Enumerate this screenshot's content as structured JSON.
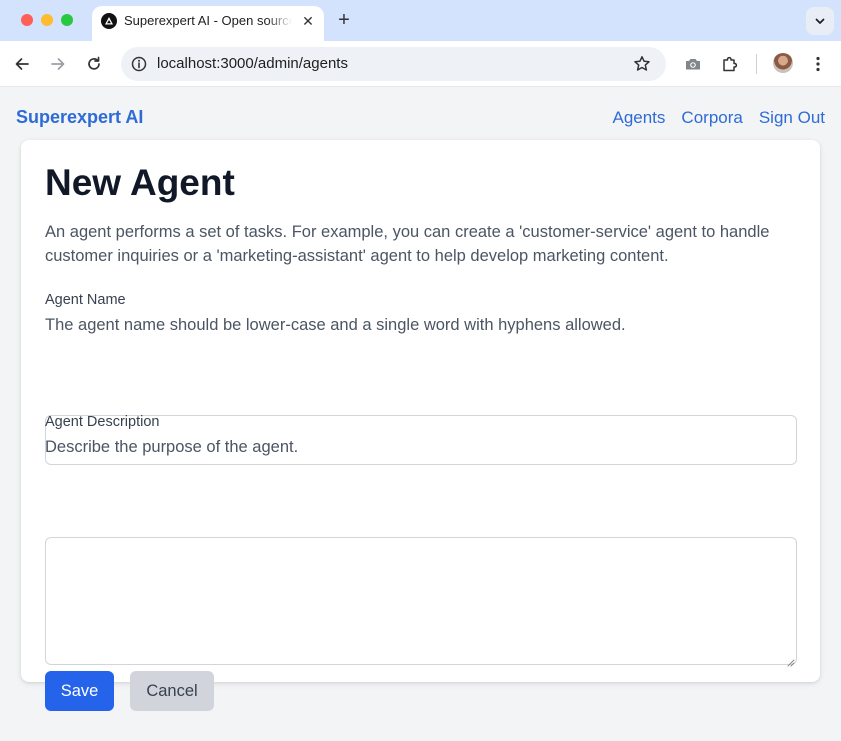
{
  "browser": {
    "tab": {
      "title": "Superexpert AI - Open source"
    },
    "address_bar": {
      "url": "localhost:3000/admin/agents"
    }
  },
  "header": {
    "brand": "Superexpert AI",
    "nav": [
      "Agents",
      "Corpora",
      "Sign Out"
    ]
  },
  "form": {
    "title": "New Agent",
    "intro": "An agent performs a set of tasks. For example, you can create a 'customer-service' agent to handle customer inquiries or a 'marketing-assistant' agent to help develop marketing content.",
    "fields": [
      {
        "label": "Agent Name",
        "help": "The agent name should be lower-case and a single word with hyphens allowed.",
        "value": ""
      },
      {
        "label": "Agent Description",
        "help": "Describe the purpose of the agent.",
        "value": ""
      }
    ],
    "buttons": {
      "save": "Save",
      "cancel": "Cancel"
    }
  },
  "colors": {
    "brand": "#2f6bd6",
    "primary_button": "#2563eb",
    "secondary_button": "#d1d5db",
    "page_background": "#f3f4f6"
  },
  "icons": [
    "back-arrow-icon",
    "forward-arrow-icon",
    "reload-icon",
    "site-info-icon",
    "bookmark-star-icon",
    "camera-icon",
    "extensions-puzzle-icon",
    "kebab-menu-icon",
    "tab-list-chevron-icon",
    "new-tab-plus-icon",
    "tab-close-icon"
  ]
}
